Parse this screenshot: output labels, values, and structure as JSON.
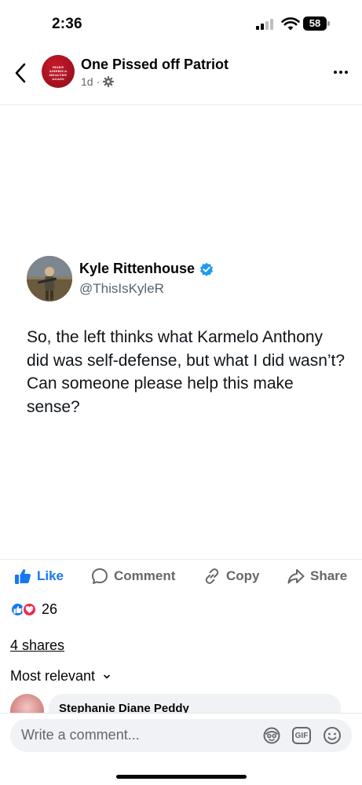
{
  "status_bar": {
    "time": "2:36",
    "battery": "58"
  },
  "header": {
    "page_name": "One Pissed off Patriot",
    "post_age": "1d",
    "separator": "·",
    "avatar_text": "MAKE AMERICA HEALTHY AGAIN"
  },
  "tweet": {
    "author_name": "Kyle Rittenhouse",
    "author_handle": "@ThisIsKyleR",
    "verified": true,
    "text": "So, the left thinks what Karmelo Anthony did was self-defense, but what I did wasn’t? Can someone please help this make sense?"
  },
  "actions": {
    "like": "Like",
    "comment": "Comment",
    "copy": "Copy",
    "share": "Share"
  },
  "reactions": {
    "count": "26",
    "types": [
      "like",
      "love"
    ]
  },
  "shares": "4 shares",
  "sort": {
    "label": "Most relevant"
  },
  "comment_preview": {
    "name": "Stephanie Diane Peddy"
  },
  "composer": {
    "placeholder": "Write a comment..."
  },
  "colors": {
    "accent": "#1877f2",
    "love": "#f0284a",
    "muted": "#65676b",
    "verified": "#1d9bf0",
    "avatar_red": "#c8192b"
  }
}
